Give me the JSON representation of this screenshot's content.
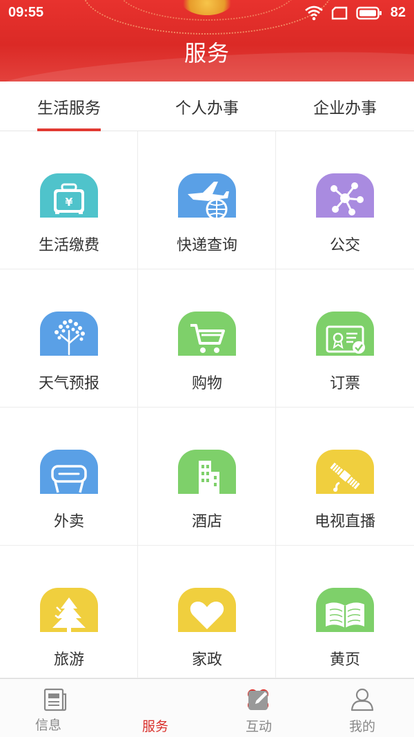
{
  "status_bar": {
    "time": "09:55",
    "battery": "82",
    "icons": [
      "wifi-icon",
      "sim-card-icon",
      "battery-icon"
    ]
  },
  "header": {
    "title": "服务",
    "background_color": "#e0302b"
  },
  "tabs": [
    {
      "label": "生活服务",
      "active": true
    },
    {
      "label": "个人办事",
      "active": false
    },
    {
      "label": "企业办事",
      "active": false
    }
  ],
  "services": [
    {
      "label": "生活缴费",
      "icon": "suitcase-yen-icon",
      "color": "#4fc3cb"
    },
    {
      "label": "快递查询",
      "icon": "airplane-globe-icon",
      "color": "#5aa0e6"
    },
    {
      "label": "公交",
      "icon": "network-nodes-icon",
      "color": "#a98be0"
    },
    {
      "label": "天气预报",
      "icon": "tree-icon",
      "color": "#5aa0e6"
    },
    {
      "label": "购物",
      "icon": "shopping-cart-icon",
      "color": "#7ed06a"
    },
    {
      "label": "订票",
      "icon": "certificate-icon",
      "color": "#7ed06a"
    },
    {
      "label": "外卖",
      "icon": "takeout-box-icon",
      "color": "#5aa0e6"
    },
    {
      "label": "酒店",
      "icon": "building-icon",
      "color": "#7ed06a"
    },
    {
      "label": "电视直播",
      "icon": "satellite-icon",
      "color": "#f0cf3e"
    },
    {
      "label": "旅游",
      "icon": "pine-tree-icon",
      "color": "#f0cf3e"
    },
    {
      "label": "家政",
      "icon": "heart-icon",
      "color": "#f0cf3e"
    },
    {
      "label": "黄页",
      "icon": "open-book-icon",
      "color": "#7ed06a"
    }
  ],
  "bottom_nav": [
    {
      "label": "信息",
      "icon": "newspaper-icon",
      "active": false
    },
    {
      "label": "服务",
      "icon": "clover-icon",
      "active": true
    },
    {
      "label": "互动",
      "icon": "edit-icon",
      "active": false
    },
    {
      "label": "我的",
      "icon": "user-icon",
      "active": false
    }
  ],
  "colors": {
    "accent": "#e13a32",
    "text": "#333333",
    "muted": "#888888"
  }
}
